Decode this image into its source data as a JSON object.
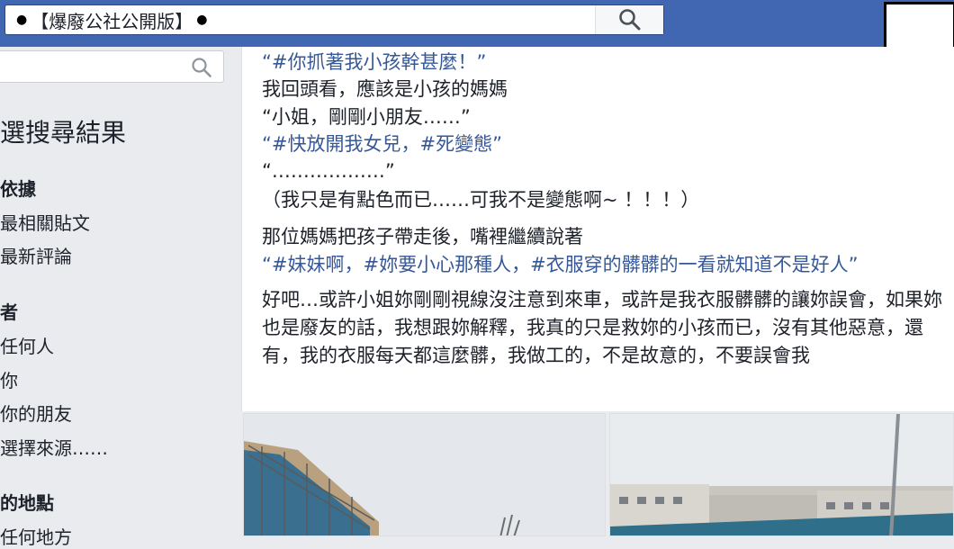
{
  "topbar": {
    "search_value": "【爆廢公社公開版】",
    "dot": "●"
  },
  "sidebar": {
    "title": "選搜尋結果",
    "sections": [
      {
        "heading": "依據",
        "items": [
          "最相關貼文",
          "最新評論"
        ]
      },
      {
        "heading": "者",
        "items": [
          "任何人",
          "你",
          "你的朋友",
          "選擇來源……"
        ]
      },
      {
        "heading": "的地點",
        "items": [
          "任何地方"
        ]
      }
    ]
  },
  "post": {
    "line1": "“#你抓著我小孩幹甚麼！”",
    "line2": "我回頭看，應該是小孩的媽媽",
    "line3": "“小姐，剛剛小朋友……”",
    "line4": "“#快放開我女兒，#死變態”",
    "line5": "“………………”",
    "line6": "（我只是有點色而已……可我不是變態啊~ ！！！）",
    "line7": "那位媽媽把孩子帶走後，嘴裡繼續說著",
    "line8": "“#妹妹啊，#妳要小心那種人，#衣服穿的髒髒的一看就知道不是好人”",
    "paragraph": "好吧…或許小姐妳剛剛視線沒注意到來車，或許是我衣服髒髒的讓妳誤會，如果妳也是廢友的話，我想跟妳解釋，我真的只是救妳的小孩而已，沒有其他惡意，還有，我的衣服每天都這麼髒，我做工的，不是故意的，不要誤會我"
  }
}
